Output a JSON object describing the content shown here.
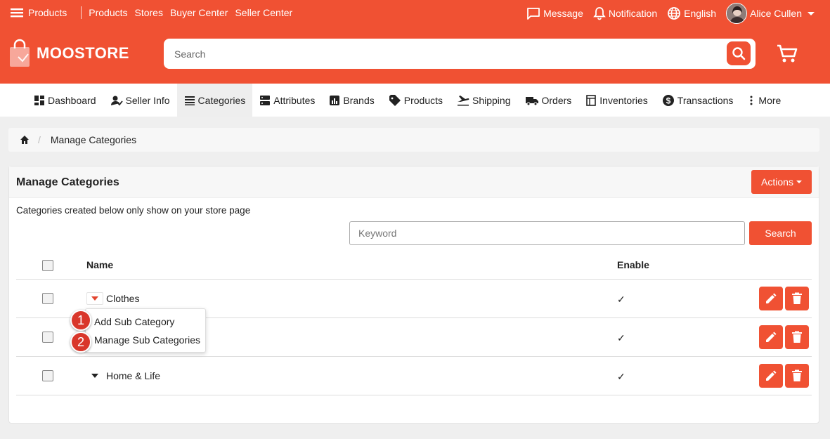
{
  "colors": {
    "brand": "#f05133",
    "badge": "#d9372b"
  },
  "top_links": {
    "products_menu": "Products",
    "products": "Products",
    "stores": "Stores",
    "buyer_center": "Buyer Center",
    "seller_center": "Seller Center"
  },
  "top_right": {
    "message": "Message",
    "notification": "Notification",
    "language": "English",
    "user": "Alice Cullen"
  },
  "logo": {
    "text": "MOOSTORE"
  },
  "search": {
    "placeholder": "Search"
  },
  "nav": [
    {
      "label": "Dashboard",
      "icon": "dashboard-icon"
    },
    {
      "label": "Seller Info",
      "icon": "seller-info-icon"
    },
    {
      "label": "Categories",
      "icon": "list-icon",
      "active": true
    },
    {
      "label": "Attributes",
      "icon": "attributes-icon"
    },
    {
      "label": "Brands",
      "icon": "brands-icon"
    },
    {
      "label": "Products",
      "icon": "tag-icon"
    },
    {
      "label": "Shipping",
      "icon": "plane-icon"
    },
    {
      "label": "Orders",
      "icon": "truck-icon"
    },
    {
      "label": "Inventories",
      "icon": "inventory-icon"
    },
    {
      "label": "Transactions",
      "icon": "dollar-icon"
    },
    {
      "label": "More",
      "icon": "more-vertical-icon"
    }
  ],
  "breadcrumb": {
    "current": "Manage Categories"
  },
  "panel": {
    "title": "Manage Categories",
    "actions_label": "Actions",
    "note": "Categories created below only show on your store page",
    "keyword_placeholder": "Keyword",
    "search_label": "Search"
  },
  "table": {
    "headers": {
      "name": "Name",
      "enable": "Enable"
    },
    "rows": [
      {
        "name": "Clothes",
        "enabled": "✓",
        "expanded": true
      },
      {
        "name": "",
        "enabled": "✓",
        "expanded": false
      },
      {
        "name": "Home & Life",
        "enabled": "✓",
        "expanded": false
      }
    ]
  },
  "dropdown": {
    "items": [
      {
        "label": "Add Sub Category",
        "badge": "1"
      },
      {
        "label": "Manage Sub Categories",
        "badge": "2"
      }
    ]
  }
}
